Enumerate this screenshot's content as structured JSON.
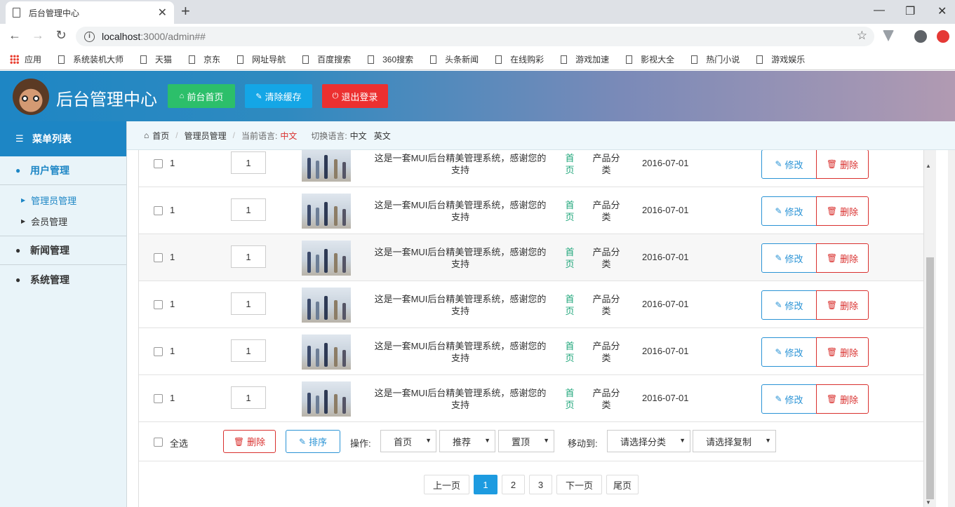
{
  "browser": {
    "tab_title": "后台管理中心",
    "url_host": "localhost",
    "url_rest": ":3000/admin##",
    "bookmarks": [
      "应用",
      "系统装机大师",
      "天猫",
      "京东",
      "网址导航",
      "百度搜索",
      "360搜索",
      "头条新闻",
      "在线购彩",
      "游戏加速",
      "影视大全",
      "热门小说",
      "游戏娱乐"
    ]
  },
  "header": {
    "title": "后台管理中心",
    "buttons": {
      "home": "前台首页",
      "cache": "清除缓存",
      "logout": "退出登录"
    },
    "colors": {
      "home": "#2cbf6a",
      "cache": "#14a6e6",
      "logout": "#ec3030"
    }
  },
  "sidebar": {
    "heading": "菜单列表",
    "groups": [
      {
        "label": "用户管理",
        "items": [
          "管理员管理",
          "会员管理"
        ]
      },
      {
        "label": "新闻管理"
      },
      {
        "label": "系统管理"
      }
    ]
  },
  "breadcrumb": {
    "home": "首页",
    "section": "管理员管理",
    "current_lang_label": "当前语言:",
    "current_lang": "中文",
    "switch_label": "切换语言:",
    "lang_zh": "中文",
    "lang_en": "英文"
  },
  "table": {
    "rows": [
      {
        "id": "1",
        "sort": "1",
        "desc": "这是一套MUI后台精美管理系统，感谢您的支持",
        "cat1": "首页",
        "cat2": "产品分类",
        "date": "2016-07-01"
      },
      {
        "id": "1",
        "sort": "1",
        "desc": "这是一套MUI后台精美管理系统，感谢您的支持",
        "cat1": "首页",
        "cat2": "产品分类",
        "date": "2016-07-01"
      },
      {
        "id": "1",
        "sort": "1",
        "desc": "这是一套MUI后台精美管理系统，感谢您的支持",
        "cat1": "首页",
        "cat2": "产品分类",
        "date": "2016-07-01"
      },
      {
        "id": "1",
        "sort": "1",
        "desc": "这是一套MUI后台精美管理系统，感谢您的支持",
        "cat1": "首页",
        "cat2": "产品分类",
        "date": "2016-07-01"
      },
      {
        "id": "1",
        "sort": "1",
        "desc": "这是一套MUI后台精美管理系统，感谢您的支持",
        "cat1": "首页",
        "cat2": "产品分类",
        "date": "2016-07-01"
      },
      {
        "id": "1",
        "sort": "1",
        "desc": "这是一套MUI后台精美管理系统，感谢您的支持",
        "cat1": "首页",
        "cat2": "产品分类",
        "date": "2016-07-01"
      }
    ],
    "edit_label": "修改",
    "delete_label": "删除"
  },
  "footer": {
    "select_all": "全选",
    "delete": "删除",
    "sort": "排序",
    "op_label": "操作:",
    "op_home": "首页",
    "op_recommend": "推荐",
    "op_top": "置顶",
    "move_label": "移动到:",
    "move_category": "请选择分类",
    "copy_select": "请选择复制"
  },
  "pagination": {
    "prev": "上一页",
    "pages": [
      "1",
      "2",
      "3"
    ],
    "current": "1",
    "next": "下一页",
    "last": "尾页"
  }
}
